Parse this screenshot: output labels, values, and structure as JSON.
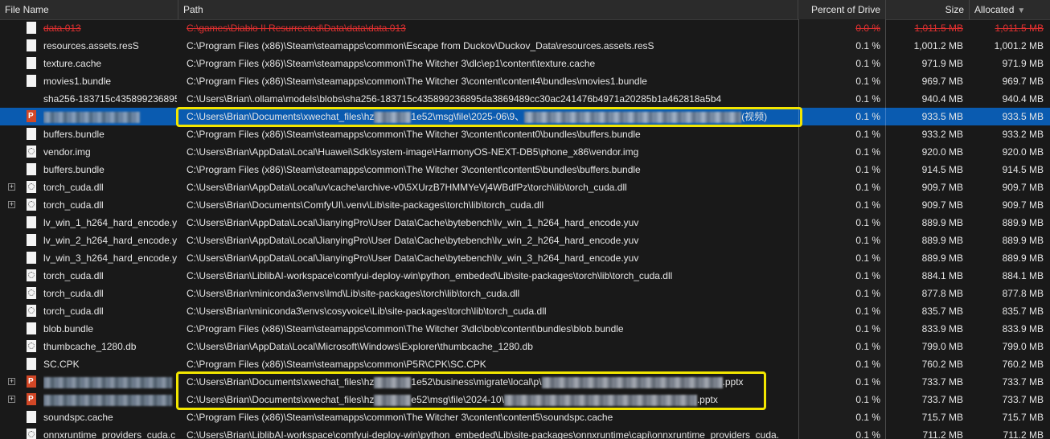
{
  "columns": {
    "name": "File Name",
    "path": "Path",
    "percent": "Percent of Drive",
    "size": "Size",
    "allocated": "Allocated"
  },
  "rows": [
    {
      "name": "data.013",
      "path": "C:\\games\\Diablo II Resurrected\\Data\\data\\data.013",
      "percent": "0.0 %",
      "size": "1,011.5 MB",
      "allocated": "1,011.5 MB",
      "icon": "file-icon"
    },
    {
      "name": "resources.assets.resS",
      "path": "C:\\Program Files (x86)\\Steam\\steamapps\\common\\Escape from Duckov\\Duckov_Data\\resources.assets.resS",
      "percent": "0.1 %",
      "size": "1,001.2 MB",
      "allocated": "1,001.2 MB",
      "icon": "file-icon"
    },
    {
      "name": "texture.cache",
      "path": "C:\\Program Files (x86)\\Steam\\steamapps\\common\\The Witcher 3\\dlc\\ep1\\content\\texture.cache",
      "percent": "0.1 %",
      "size": "971.9 MB",
      "allocated": "971.9 MB",
      "icon": "file-icon"
    },
    {
      "name": "movies1.bundle",
      "path": "C:\\Program Files (x86)\\Steam\\steamapps\\common\\The Witcher 3\\content\\content4\\bundles\\movies1.bundle",
      "percent": "0.1 %",
      "size": "969.7 MB",
      "allocated": "969.7 MB",
      "icon": "file-icon"
    },
    {
      "name": "sha256-183715c435899236895d",
      "path": "C:\\Users\\Brian\\.ollama\\models\\blobs\\sha256-183715c435899236895da3869489cc30ac241476b4971a20285b1a462818a5b4",
      "percent": "0.1 %",
      "size": "940.4 MB",
      "allocated": "940.4 MB",
      "icon": "none"
    },
    {
      "name": "",
      "path_a": "C:\\Users\\Brian\\Documents\\xwechat_files\\hz",
      "path_b": "1e52\\msg\\file\\2025-06\\9、",
      "path_c": "(视频)",
      "percent": "0.1 %",
      "size": "933.5 MB",
      "allocated": "933.5 MB",
      "icon": "pptx-icon"
    },
    {
      "name": "buffers.bundle",
      "path": "C:\\Program Files (x86)\\Steam\\steamapps\\common\\The Witcher 3\\content\\content0\\bundles\\buffers.bundle",
      "percent": "0.1 %",
      "size": "933.2 MB",
      "allocated": "933.2 MB",
      "icon": "file-icon"
    },
    {
      "name": "vendor.img",
      "path": "C:\\Users\\Brian\\AppData\\Local\\Huawei\\Sdk\\system-image\\HarmonyOS-NEXT-DB5\\phone_x86\\vendor.img",
      "percent": "0.1 %",
      "size": "920.0 MB",
      "allocated": "920.0 MB",
      "icon": "gear-file-icon"
    },
    {
      "name": "buffers.bundle",
      "path": "C:\\Program Files (x86)\\Steam\\steamapps\\common\\The Witcher 3\\content\\content5\\bundles\\buffers.bundle",
      "percent": "0.1 %",
      "size": "914.5 MB",
      "allocated": "914.5 MB",
      "icon": "file-icon"
    },
    {
      "name": "torch_cuda.dll",
      "path": "C:\\Users\\Brian\\AppData\\Local\\uv\\cache\\archive-v0\\5XUrzB7HMMYeVj4WBdfPz\\torch\\lib\\torch_cuda.dll",
      "percent": "0.1 %",
      "size": "909.7 MB",
      "allocated": "909.7 MB",
      "icon": "gear-file-icon"
    },
    {
      "name": "torch_cuda.dll",
      "path": "C:\\Users\\Brian\\Documents\\ComfyUI\\.venv\\Lib\\site-packages\\torch\\lib\\torch_cuda.dll",
      "percent": "0.1 %",
      "size": "909.7 MB",
      "allocated": "909.7 MB",
      "icon": "gear-file-icon"
    },
    {
      "name": "lv_win_1_h264_hard_encode.yu",
      "path": "C:\\Users\\Brian\\AppData\\Local\\JianyingPro\\User Data\\Cache\\bytebench\\lv_win_1_h264_hard_encode.yuv",
      "percent": "0.1 %",
      "size": "889.9 MB",
      "allocated": "889.9 MB",
      "icon": "file-icon"
    },
    {
      "name": "lv_win_2_h264_hard_encode.yu",
      "path": "C:\\Users\\Brian\\AppData\\Local\\JianyingPro\\User Data\\Cache\\bytebench\\lv_win_2_h264_hard_encode.yuv",
      "percent": "0.1 %",
      "size": "889.9 MB",
      "allocated": "889.9 MB",
      "icon": "file-icon"
    },
    {
      "name": "lv_win_3_h264_hard_encode.yu",
      "path": "C:\\Users\\Brian\\AppData\\Local\\JianyingPro\\User Data\\Cache\\bytebench\\lv_win_3_h264_hard_encode.yuv",
      "percent": "0.1 %",
      "size": "889.9 MB",
      "allocated": "889.9 MB",
      "icon": "file-icon"
    },
    {
      "name": "torch_cuda.dll",
      "path": "C:\\Users\\Brian\\LiblibAI-workspace\\comfyui-deploy-win\\python_embeded\\Lib\\site-packages\\torch\\lib\\torch_cuda.dll",
      "percent": "0.1 %",
      "size": "884.1 MB",
      "allocated": "884.1 MB",
      "icon": "gear-file-icon"
    },
    {
      "name": "torch_cuda.dll",
      "path": "C:\\Users\\Brian\\miniconda3\\envs\\lmd\\Lib\\site-packages\\torch\\lib\\torch_cuda.dll",
      "percent": "0.1 %",
      "size": "877.8 MB",
      "allocated": "877.8 MB",
      "icon": "gear-file-icon"
    },
    {
      "name": "torch_cuda.dll",
      "path": "C:\\Users\\Brian\\miniconda3\\envs\\cosyvoice\\Lib\\site-packages\\torch\\lib\\torch_cuda.dll",
      "percent": "0.1 %",
      "size": "835.7 MB",
      "allocated": "835.7 MB",
      "icon": "gear-file-icon"
    },
    {
      "name": "blob.bundle",
      "path": "C:\\Program Files (x86)\\Steam\\steamapps\\common\\The Witcher 3\\dlc\\bob\\content\\bundles\\blob.bundle",
      "percent": "0.1 %",
      "size": "833.9 MB",
      "allocated": "833.9 MB",
      "icon": "file-icon"
    },
    {
      "name": "thumbcache_1280.db",
      "path": "C:\\Users\\Brian\\AppData\\Local\\Microsoft\\Windows\\Explorer\\thumbcache_1280.db",
      "percent": "0.1 %",
      "size": "799.0 MB",
      "allocated": "799.0 MB",
      "icon": "gear-file-icon"
    },
    {
      "name": "SC.CPK",
      "path": "C:\\Program Files (x86)\\Steam\\steamapps\\common\\P5R\\CPK\\SC.CPK",
      "percent": "0.1 %",
      "size": "760.2 MB",
      "allocated": "760.2 MB",
      "icon": "file-icon"
    },
    {
      "name": "",
      "path_a": "C:\\Users\\Brian\\Documents\\xwechat_files\\hz",
      "path_b": "1e52\\business\\migrate\\local\\p\\",
      "path_c": ".pptx",
      "percent": "0.1 %",
      "size": "733.7 MB",
      "allocated": "733.7 MB",
      "icon": "pptx-icon"
    },
    {
      "name": "",
      "path_a": "C:\\Users\\Brian\\Documents\\xwechat_files\\hz",
      "path_b": "e52\\msg\\file\\2024-10\\",
      "path_c": ".pptx",
      "percent": "0.1 %",
      "size": "733.7 MB",
      "allocated": "733.7 MB",
      "icon": "pptx-icon"
    },
    {
      "name": "soundspc.cache",
      "path": "C:\\Program Files (x86)\\Steam\\steamapps\\common\\The Witcher 3\\content\\content5\\soundspc.cache",
      "percent": "0.1 %",
      "size": "715.7 MB",
      "allocated": "715.7 MB",
      "icon": "file-icon"
    },
    {
      "name": "onnxruntime_providers_cuda.c",
      "path": "C:\\Users\\Brian\\LiblibAI-workspace\\comfyui-deploy-win\\python_embeded\\Lib\\site-packages\\onnxruntime\\capi\\onnxruntime_providers_cuda.",
      "percent": "0.1 %",
      "size": "711.2 MB",
      "allocated": "711.2 MB",
      "icon": "gear-file-icon"
    }
  ]
}
